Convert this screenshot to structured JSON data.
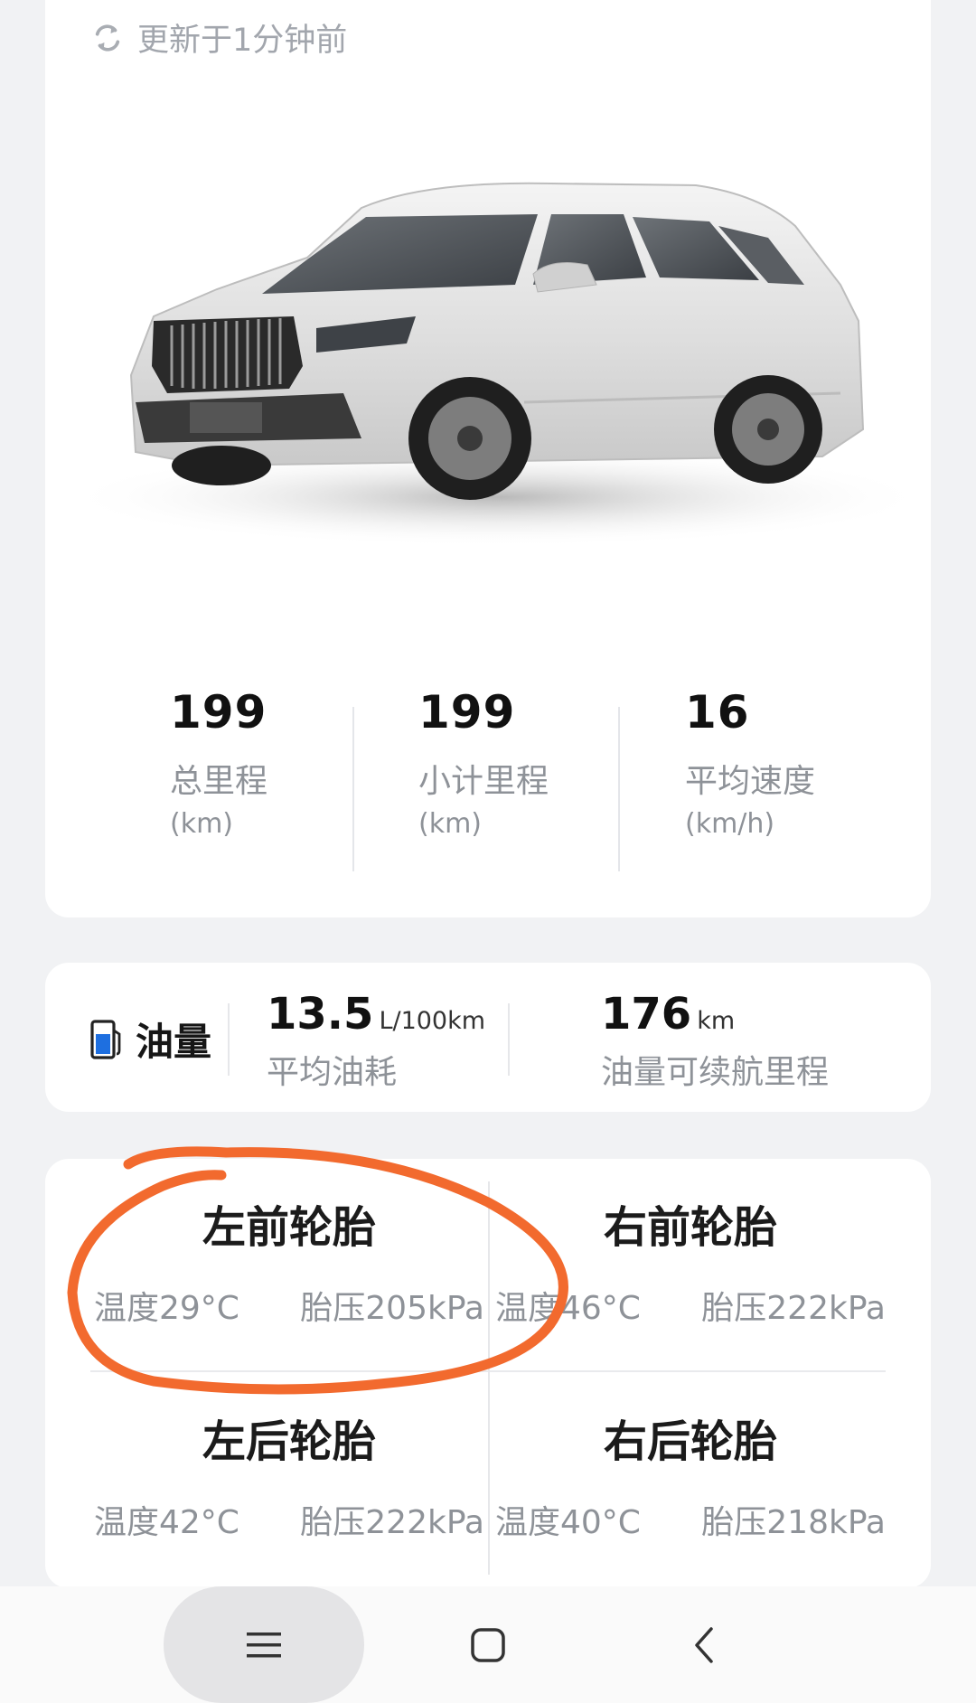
{
  "update": {
    "text": "更新于1分钟前"
  },
  "stats": [
    {
      "value": "199",
      "label": "总里程",
      "unit": "(km)"
    },
    {
      "value": "199",
      "label": "小计里程",
      "unit": "(km)"
    },
    {
      "value": "16",
      "label": "平均速度",
      "unit": "(km/h)"
    }
  ],
  "fuel": {
    "title": "油量",
    "consumption": {
      "value": "13.5",
      "unit": "L/100km",
      "label": "平均油耗"
    },
    "range": {
      "value": "176",
      "unit": "km",
      "label": "油量可续航里程"
    }
  },
  "tires": [
    {
      "name": "左前轮胎",
      "temp": "温度29°C",
      "pressure": "胎压205kPa"
    },
    {
      "name": "右前轮胎",
      "temp": "温度46°C",
      "pressure": "胎压222kPa"
    },
    {
      "name": "左后轮胎",
      "temp": "温度42°C",
      "pressure": "胎压222kPa"
    },
    {
      "name": "右后轮胎",
      "temp": "温度40°C",
      "pressure": "胎压218kPa"
    }
  ],
  "colors": {
    "annotation": "#f26a2e",
    "fuel_icon": "#1e6fe0",
    "background": "#f1f2f4"
  },
  "icons": {
    "refresh": "refresh-icon",
    "fuel": "fuel-pump-icon",
    "nav_menu": "menu-icon",
    "nav_home": "home-icon",
    "nav_back": "back-icon"
  }
}
